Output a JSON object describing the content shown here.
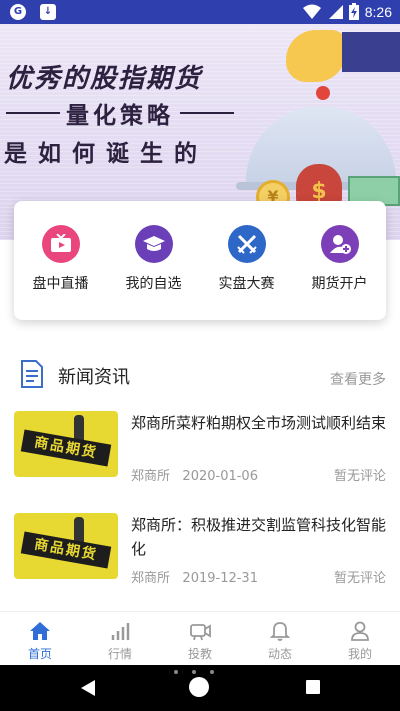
{
  "status_bar": {
    "time": "8:26",
    "left_icons": [
      "app-notification-icon",
      "download-notification-icon"
    ],
    "right_icons": [
      "wifi-icon",
      "signal-icon",
      "battery-charging-icon"
    ]
  },
  "banner": {
    "line1": "优秀的股指期货",
    "line2": "量化策略",
    "line3": "是如何诞生的"
  },
  "quick_menu": {
    "items": [
      {
        "label": "盘中直播",
        "icon": "tv-play-icon",
        "color": "#e8467c"
      },
      {
        "label": "我的自选",
        "icon": "graduation-cap-icon",
        "color": "#6b3fb8"
      },
      {
        "label": "实盘大赛",
        "icon": "crossed-swords-icon",
        "color": "#2d67c8"
      },
      {
        "label": "期货开户",
        "icon": "add-user-icon",
        "color": "#7c3fb8"
      }
    ]
  },
  "news": {
    "title": "新闻资讯",
    "more_label": "查看更多",
    "items": [
      {
        "headline": "郑商所菜籽粕期权全市场测试顺利结束",
        "source": "郑商所",
        "date": "2020-01-06",
        "comments": "暂无评论",
        "thumb_text": "商品期货"
      },
      {
        "headline": "郑商所：积极推进交割监管科技化智能化",
        "source": "郑商所",
        "date": "2019-12-31",
        "comments": "暂无评论",
        "thumb_text": "商品期货"
      }
    ]
  },
  "tab_bar": {
    "active_color": "#2e6ed6",
    "tabs": [
      {
        "label": "首页",
        "icon": "home-icon",
        "active": true
      },
      {
        "label": "行情",
        "icon": "bar-chart-icon",
        "active": false
      },
      {
        "label": "投教",
        "icon": "video-camera-icon",
        "active": false
      },
      {
        "label": "动态",
        "icon": "bell-icon",
        "active": false
      },
      {
        "label": "我的",
        "icon": "user-icon",
        "active": false
      }
    ]
  },
  "colors": {
    "status_bar": "#2f3fae",
    "accent": "#2e6ed6"
  }
}
